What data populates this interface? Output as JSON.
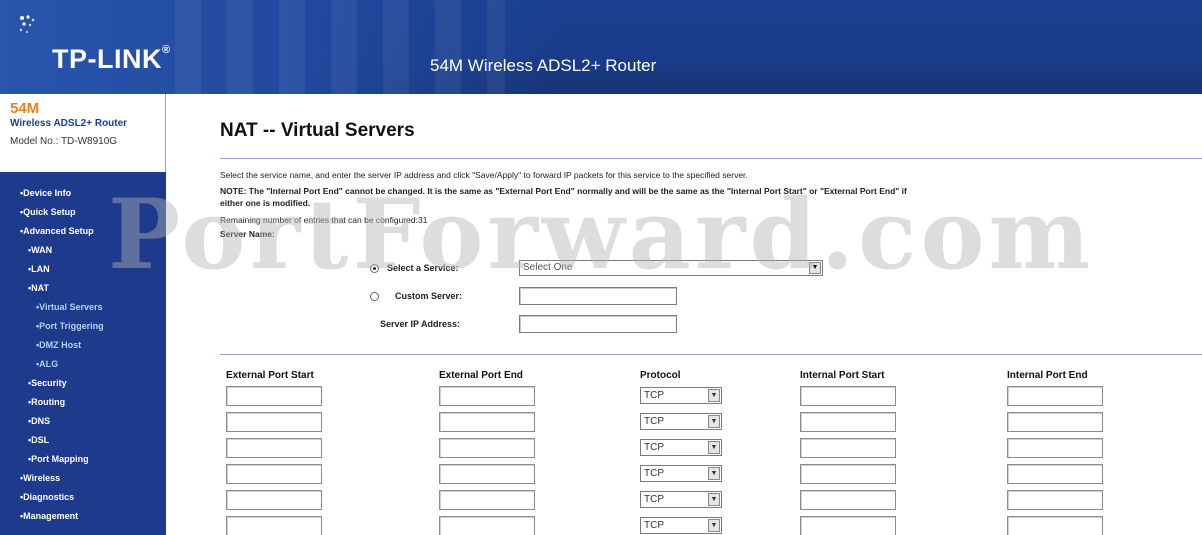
{
  "header": {
    "logo": "TP-LINK",
    "logo_tm": "®",
    "title": "54M Wireless ADSL2+ Router"
  },
  "sidebar": {
    "brand_54m": "54M",
    "brand_name": "Wireless ADSL2+ Router",
    "model": "Model No.: TD-W8910G",
    "items": [
      {
        "label": "•Device Info",
        "level": 1
      },
      {
        "label": "•Quick Setup",
        "level": 1
      },
      {
        "label": "•Advanced Setup",
        "level": 1
      },
      {
        "label": "•WAN",
        "level": 2
      },
      {
        "label": "•LAN",
        "level": 2
      },
      {
        "label": "•NAT",
        "level": 2
      },
      {
        "label": "•Virtual Servers",
        "level": 3
      },
      {
        "label": "•Port Triggering",
        "level": 3
      },
      {
        "label": "•DMZ Host",
        "level": 3
      },
      {
        "label": "•ALG",
        "level": 3
      },
      {
        "label": "•Security",
        "level": 2
      },
      {
        "label": "•Routing",
        "level": 2
      },
      {
        "label": "•DNS",
        "level": 2
      },
      {
        "label": "•DSL",
        "level": 2
      },
      {
        "label": "•Port Mapping",
        "level": 2
      },
      {
        "label": "•Wireless",
        "level": 1
      },
      {
        "label": "•Diagnostics",
        "level": 1
      },
      {
        "label": "•Management",
        "level": 1
      }
    ]
  },
  "main": {
    "title": "NAT -- Virtual Servers",
    "intro": "Select the service name, and enter the server IP address and click \"Save/Apply\" to forward IP packets for this service to the specified server.",
    "note_line1": "NOTE: The \"Internal Port End\" cannot be changed. It is the same as \"External Port End\" normally and will be the same as the \"Internal Port Start\" or \"External Port End\" if",
    "note_line2": "either one is modified.",
    "remaining": "Remaining number of entries that can be configured:31",
    "server_name_label": "Server Name:",
    "select_service_label": "Select a Service:",
    "select_service_value": "Select One",
    "custom_server_label": "Custom Server:",
    "server_ip_label": "Server IP Address:",
    "columns": [
      "External Port Start",
      "External Port End",
      "Protocol",
      "Internal Port Start",
      "Internal Port End"
    ],
    "rows": [
      {
        "protocol": "TCP"
      },
      {
        "protocol": "TCP"
      },
      {
        "protocol": "TCP"
      },
      {
        "protocol": "TCP"
      },
      {
        "protocol": "TCP"
      },
      {
        "protocol": "TCP"
      }
    ]
  },
  "watermark": "PortForward.com"
}
